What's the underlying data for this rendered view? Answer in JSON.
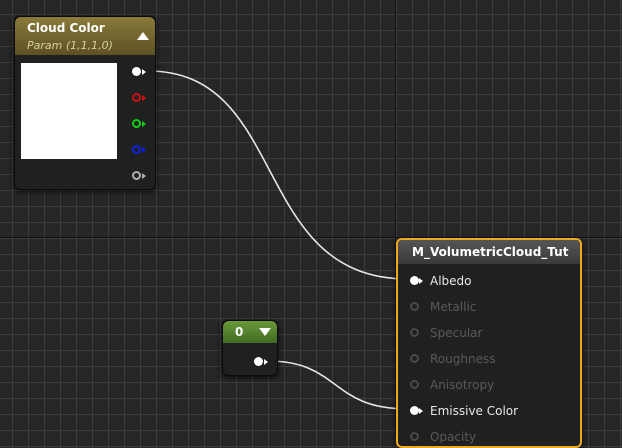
{
  "cloud_node": {
    "title": "Cloud Color",
    "subtitle": "Param (1,1,1,0)",
    "swatch_color": "#ffffff",
    "pins": [
      {
        "name": "rgb",
        "color": "#ffffff"
      },
      {
        "name": "r",
        "color": "#d01010"
      },
      {
        "name": "g",
        "color": "#10d010"
      },
      {
        "name": "b",
        "color": "#1020e0"
      },
      {
        "name": "a",
        "color": "#b0b0b0"
      }
    ]
  },
  "constant_node": {
    "value": "0"
  },
  "material_node": {
    "title": "M_VolumetricCloud_Tut",
    "inputs": [
      {
        "label": "Albedo",
        "connected": true
      },
      {
        "label": "Metallic",
        "connected": false
      },
      {
        "label": "Specular",
        "connected": false
      },
      {
        "label": "Roughness",
        "connected": false
      },
      {
        "label": "Anisotropy",
        "connected": false
      },
      {
        "label": "Emissive Color",
        "connected": true
      },
      {
        "label": "Opacity",
        "connected": false
      }
    ]
  },
  "colors": {
    "param_header": "#8a7a3a",
    "constant_header": "#6a9a3a",
    "selection_border": "#f0a81c",
    "wire": "#e6e6e6"
  }
}
